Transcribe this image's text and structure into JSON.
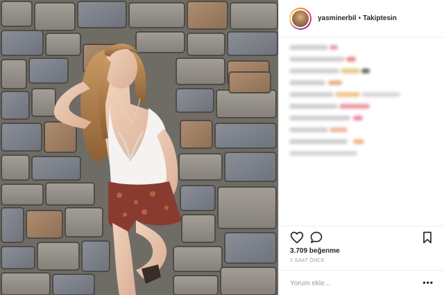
{
  "post": {
    "image_alt": "",
    "image_subject": "woman-leaning-on-stone-wall"
  },
  "header": {
    "username": "yasminerbil",
    "separator": "•",
    "follow_label": "Takiptesin"
  },
  "comments": {
    "blurred": true,
    "count_visible": 10
  },
  "actions": {
    "like_icon": "heart-icon",
    "comment_icon": "comment-bubble-icon",
    "save_icon": "bookmark-icon"
  },
  "likes_text": "3.709 beğenme",
  "timestamp": "1 SAAT ÖNCE",
  "comment_box": {
    "placeholder": "Yorum ekle...",
    "more_label": "•••"
  },
  "colors": {
    "text": "#262626",
    "muted": "#999999",
    "divider": "#efefef",
    "accent": "#dd2a7b"
  }
}
